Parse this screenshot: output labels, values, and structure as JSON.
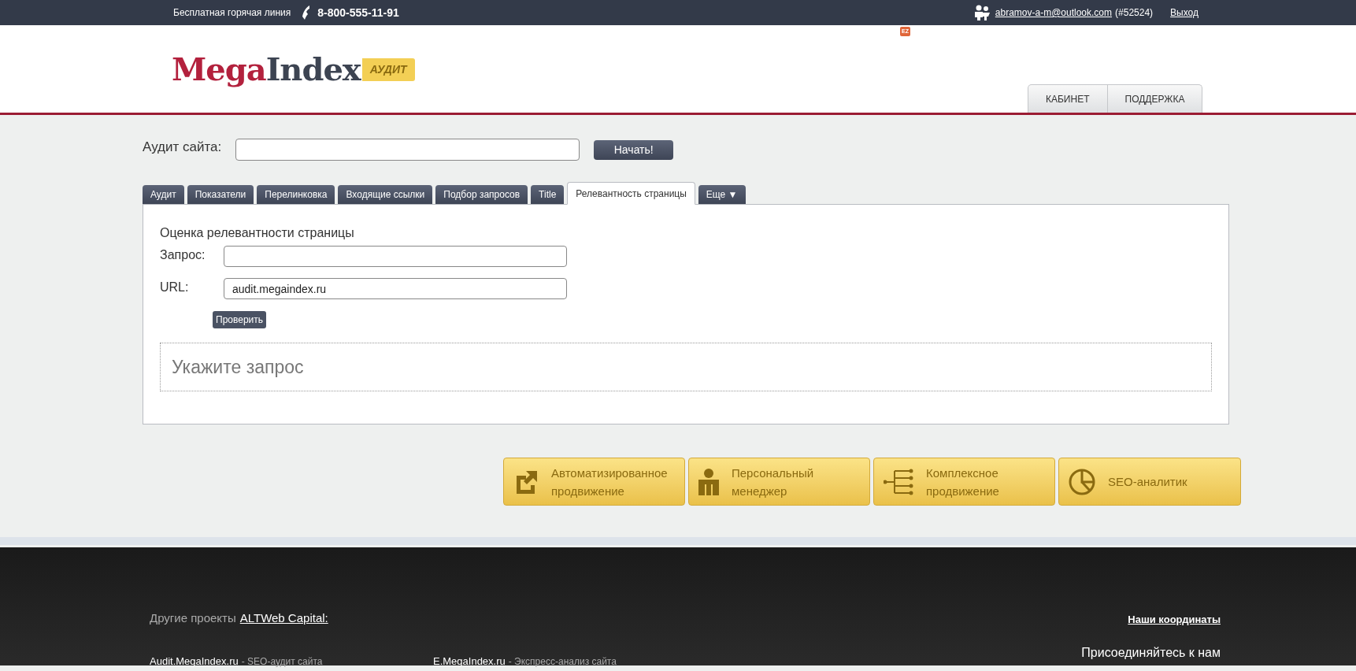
{
  "top_bar": {
    "hotline_label": "Бесплатная горячая линия",
    "phone": "8-800-555-11-91",
    "user_email": "abramov-a-m@outlook.com",
    "user_id": "(#52524)",
    "logout": "Выход",
    "ez_badge": "EZ"
  },
  "header": {
    "logo": {
      "first": "Mega",
      "second": "Index",
      "badge": "АУДИТ"
    },
    "nav": [
      {
        "label": "КАБИНЕТ",
        "selected": false
      },
      {
        "label": "ПОДДЕРЖКА",
        "selected": false
      }
    ]
  },
  "audit_form": {
    "label": "Аудит сайта:",
    "button": "Начать!"
  },
  "tabs": [
    {
      "label": "Аудит",
      "selected": false
    },
    {
      "label": "Показатели",
      "selected": false
    },
    {
      "label": "Перелинковка",
      "selected": false
    },
    {
      "label": "Входящие ссылки",
      "selected": false
    },
    {
      "label": "Подбор запросов",
      "selected": false
    },
    {
      "label": "Title",
      "selected": false
    },
    {
      "label": "Релевантность страницы",
      "selected": true
    },
    {
      "label": "Еще ▼",
      "selected": false
    }
  ],
  "panel": {
    "title": "Оценка релевантности страницы",
    "fields": [
      {
        "label": "Запрос:"
      },
      {
        "label": "URL:",
        "value": "audit.megaindex.ru"
      }
    ],
    "check_button": "Проверить",
    "result": "Укажите запрос"
  },
  "services": [
    {
      "kind": "external",
      "title": "Автоматизированное продвижение"
    },
    {
      "kind": "person",
      "title": "Персональный менеджер"
    },
    {
      "kind": "tree",
      "title": "Комплексное продвижение"
    },
    {
      "kind": "pie",
      "title": "SEO-аналитик"
    }
  ],
  "footer": {
    "other_projects_label": "Другие проекты",
    "other_projects_link": "ALTWeb Capital:",
    "coordinates_link": "Наши координаты",
    "join_label": "Присоединяйтесь к нам",
    "projects": [
      {
        "link": "Audit.MegaIndex.ru",
        "description": "- SEO-аудит сайта"
      },
      {
        "link": "E.MegaIndex.ru",
        "description": "- Экспресс-анализ сайта"
      }
    ]
  }
}
